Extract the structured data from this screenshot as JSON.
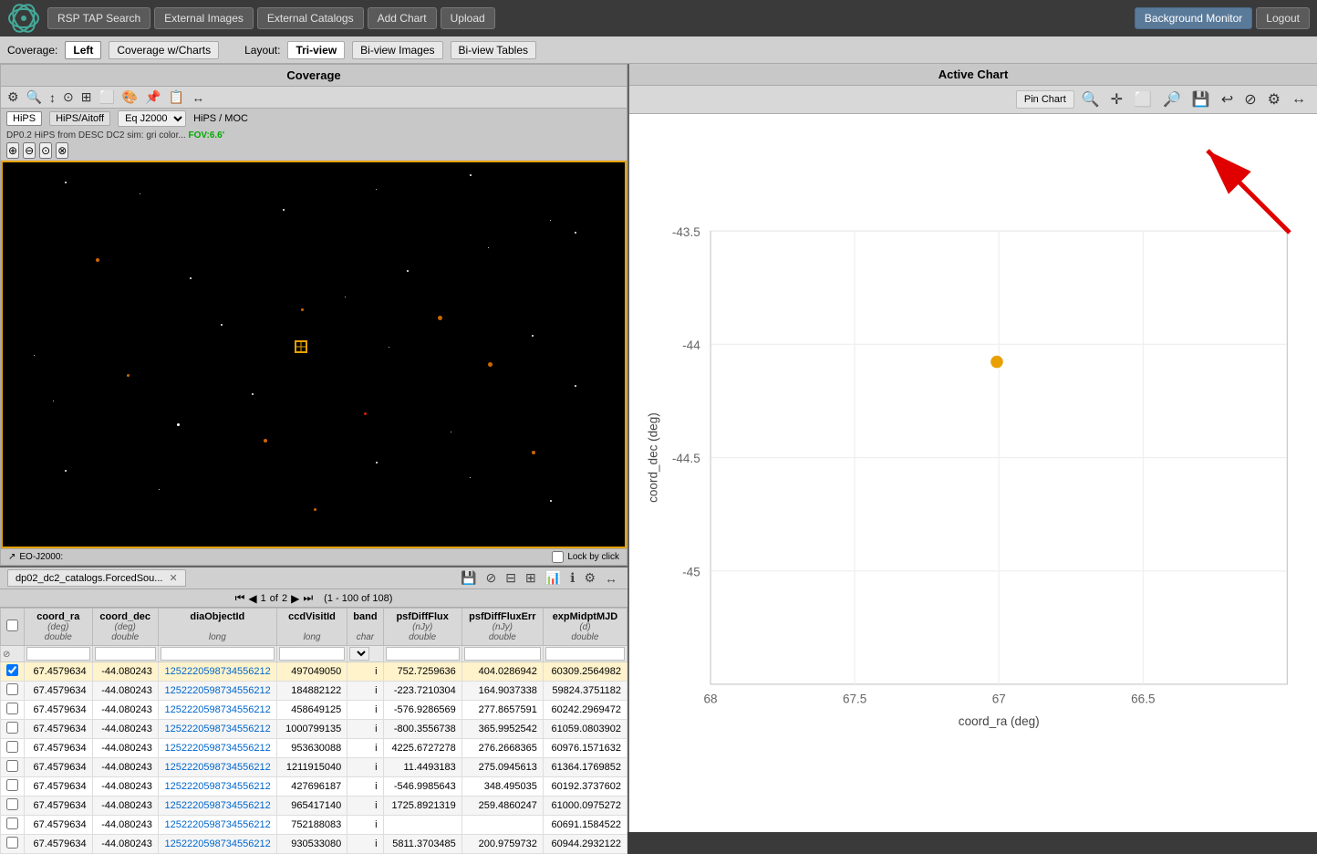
{
  "nav": {
    "logo_alt": "RSP Logo",
    "buttons": [
      "RSP TAP Search",
      "External Images",
      "External Catalogs",
      "Add Chart",
      "Upload"
    ],
    "right_buttons": [
      "Background Monitor",
      "Logout"
    ]
  },
  "coverage_bar": {
    "label": "Coverage:",
    "cov_buttons": [
      "Left",
      "Coverage w/Charts"
    ],
    "layout_label": "Layout:",
    "layout_buttons": [
      "Tri-view",
      "Bi-view Images",
      "Bi-view Tables"
    ],
    "active_cov": "Left",
    "active_layout": "Tri-view"
  },
  "coverage_panel": {
    "title": "Coverage",
    "hips_buttons": [
      "HiPS",
      "HiPS/Aitoff"
    ],
    "coord_select": "Eq J2000",
    "hips_moc": "HiPS / MOC",
    "info_text": "DP0.2 HiPS from DESC DC2 sim: gri color...",
    "fov": "FOV:6.6'",
    "footer_left": "EO-J2000:",
    "lock_label": "Lock by click"
  },
  "chart_panel": {
    "title": "Active Chart",
    "pin_label": "Pin Chart",
    "y_axis_label": "coord_dec (deg)",
    "x_axis_label": "coord_ra (deg)",
    "y_ticks": [
      "-43.5",
      "-44",
      "-44.5",
      "-45"
    ],
    "x_ticks": [
      "68",
      "67.5",
      "67",
      "66.5"
    ],
    "data_point": {
      "x": 0.38,
      "y": 0.35,
      "color": "#e8a000"
    }
  },
  "table_panel": {
    "tab_label": "dp02_dc2_catalogs.ForcedSou...",
    "pagination": {
      "current_page": "1",
      "total_pages": "2",
      "range": "1 - 100 of 108"
    },
    "columns": [
      {
        "label": "coord_ra",
        "sub": "(deg)",
        "type": "double"
      },
      {
        "label": "coord_dec",
        "sub": "(deg)",
        "type": "double"
      },
      {
        "label": "diaObjectId",
        "sub": "",
        "type": "long"
      },
      {
        "label": "ccdVisitId",
        "sub": "",
        "type": "long"
      },
      {
        "label": "band",
        "sub": "",
        "type": "char"
      },
      {
        "label": "psfDiffFlux",
        "sub": "(nJy)",
        "type": "double"
      },
      {
        "label": "psfDiffFluxErr",
        "sub": "(nJy)",
        "type": "double"
      },
      {
        "label": "expMidptMJD",
        "sub": "(d)",
        "type": "double"
      }
    ],
    "rows": [
      {
        "selected": true,
        "coord_ra": "67.4579634",
        "coord_dec": "-44.080243",
        "diaObjectId": "125222059873455621​2",
        "ccdVisitId": "497049050",
        "band": "i",
        "psfDiffFlux": "752.7259636",
        "psfDiffFluxErr": "404.0286942",
        "expMidptMJD": "60309.2564982"
      },
      {
        "selected": false,
        "coord_ra": "67.4579634",
        "coord_dec": "-44.080243",
        "diaObjectId": "125222059873455621​2",
        "ccdVisitId": "184882122",
        "band": "i",
        "psfDiffFlux": "-223.7210304",
        "psfDiffFluxErr": "164.9037338",
        "expMidptMJD": "59824.3751182"
      },
      {
        "selected": false,
        "coord_ra": "67.4579634",
        "coord_dec": "-44.080243",
        "diaObjectId": "125222059873455621​2",
        "ccdVisitId": "458649125",
        "band": "i",
        "psfDiffFlux": "-576.9286569",
        "psfDiffFluxErr": "277.8657591",
        "expMidptMJD": "60242.2969472"
      },
      {
        "selected": false,
        "coord_ra": "67.4579634",
        "coord_dec": "-44.080243",
        "diaObjectId": "125222059873455621​2",
        "ccdVisitId": "1000799135",
        "band": "i",
        "psfDiffFlux": "-800.3556738",
        "psfDiffFluxErr": "365.9952542",
        "expMidptMJD": "61059.0803902"
      },
      {
        "selected": false,
        "coord_ra": "67.4579634",
        "coord_dec": "-44.080243",
        "diaObjectId": "125222059873455621​2",
        "ccdVisitId": "953630088",
        "band": "i",
        "psfDiffFlux": "4225.6727278",
        "psfDiffFluxErr": "276.2668365",
        "expMidptMJD": "60976.1571632"
      },
      {
        "selected": false,
        "coord_ra": "67.4579634",
        "coord_dec": "-44.080243",
        "diaObjectId": "125222059873455621​2",
        "ccdVisitId": "1211915040",
        "band": "i",
        "psfDiffFlux": "11.4493183",
        "psfDiffFluxErr": "275.0945613",
        "expMidptMJD": "61364.1769852"
      },
      {
        "selected": false,
        "coord_ra": "67.4579634",
        "coord_dec": "-44.080243",
        "diaObjectId": "125222059873455621​2",
        "ccdVisitId": "427696187",
        "band": "i",
        "psfDiffFlux": "-546.9985643",
        "psfDiffFluxErr": "348.495035",
        "expMidptMJD": "60192.3737602"
      },
      {
        "selected": false,
        "coord_ra": "67.4579634",
        "coord_dec": "-44.080243",
        "diaObjectId": "125222059873455621​2",
        "ccdVisitId": "965417140",
        "band": "i",
        "psfDiffFlux": "1725.8921319",
        "psfDiffFluxErr": "259.4860247",
        "expMidptMJD": "61000.0975272"
      },
      {
        "selected": false,
        "coord_ra": "67.4579634",
        "coord_dec": "-44.080243",
        "diaObjectId": "125222059873455621​2",
        "ccdVisitId": "752188083",
        "band": "i",
        "psfDiffFlux": "",
        "psfDiffFluxErr": "",
        "expMidptMJD": "60691.1584522"
      },
      {
        "selected": false,
        "coord_ra": "67.4579634",
        "coord_dec": "-44.080243",
        "diaObjectId": "125222059873455621​2",
        "ccdVisitId": "930533080",
        "band": "i",
        "psfDiffFlux": "5811.3703485",
        "psfDiffFluxErr": "200.9759732",
        "expMidptMJD": "60944.2932122"
      }
    ]
  }
}
